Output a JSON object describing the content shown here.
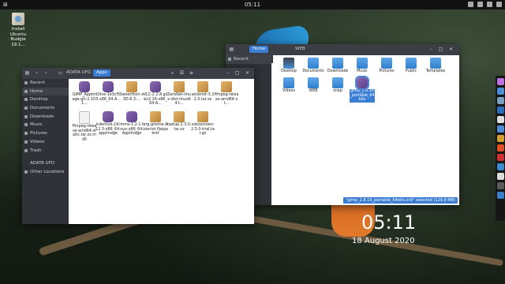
{
  "topbar": {
    "clock": "05:11"
  },
  "desktop_icon": {
    "label": "Install Ubuntu Budgie 19.1..."
  },
  "win1": {
    "breadcrumb_drive": "ADATA UFD",
    "breadcrumb_folder": "Apps",
    "sidebar": [
      {
        "label": "Recent"
      },
      {
        "label": "Home"
      },
      {
        "label": "Desktop"
      },
      {
        "label": "Documents"
      },
      {
        "label": "Downloads"
      },
      {
        "label": "Music"
      },
      {
        "label": "Pictures"
      },
      {
        "label": "Videos"
      },
      {
        "label": "Trash"
      },
      {
        "label": "ADATA UFD"
      },
      {
        "label": "Other Locations"
      }
    ],
    "files": [
      {
        "name": "GIMP_AppImage-git-2.10.1...",
        "icon": "purple"
      },
      {
        "name": "Olive-1e3cf53-x86_64.A...",
        "icon": "purple"
      },
      {
        "name": "SweetHom e3D-6.3-...",
        "icon": "box"
      },
      {
        "name": "VLC-2.2.8.glibc2.16-x86_64.A...",
        "icon": "purple"
      },
      {
        "name": "ZeroNet-linux-dist-linux64.t...",
        "icon": "box"
      },
      {
        "name": "aisleriot-3.22.0.tar.xz",
        "icon": "box"
      },
      {
        "name": "ffmpeg-release-amd64-st...",
        "icon": "box"
      },
      {
        "name": "ffmpeg-release-amd64-static.tar.xz.md5",
        "icon": "doc"
      },
      {
        "name": "kdenlive-19.12.3-x86_64.appimage",
        "icon": "purple"
      },
      {
        "name": "lmms-1.2.1-linux-x86_64.AppImage",
        "icon": "purple"
      },
      {
        "name": "org.gnome.Aisleriot.flatpakref",
        "icon": "box"
      },
      {
        "name": "tsetup.2.3.0.tar.xz",
        "icon": "box"
      },
      {
        "name": "vokoscreen-2.5.0-trial.tar.gz",
        "icon": "box"
      }
    ]
  },
  "win2": {
    "tab_home": "Home",
    "tab_web": "WEB",
    "sidebar": [
      {
        "label": "Recent"
      }
    ],
    "folders": [
      {
        "name": "Desktop",
        "icon": "dark"
      },
      {
        "name": "Documents",
        "icon": "folder"
      },
      {
        "name": "Downloads",
        "icon": "folder"
      },
      {
        "name": "Music",
        "icon": "folder"
      },
      {
        "name": "Pictures",
        "icon": "folder"
      },
      {
        "name": "Public",
        "icon": "folder"
      },
      {
        "name": "Templates",
        "icon": "folder"
      },
      {
        "name": "Videos",
        "icon": "folder"
      },
      {
        "name": "WEB",
        "icon": "folder"
      },
      {
        "name": "snap",
        "icon": "folder"
      },
      {
        "name": "gimp_2.8.16_portable_64bits",
        "icon": "selected"
      }
    ],
    "status": "\"gimp_2.8.16_portable_64bits.or9\" selected (129.9 MB)"
  },
  "clock_widget": {
    "time": "05:11",
    "date": "18 August 2020"
  }
}
